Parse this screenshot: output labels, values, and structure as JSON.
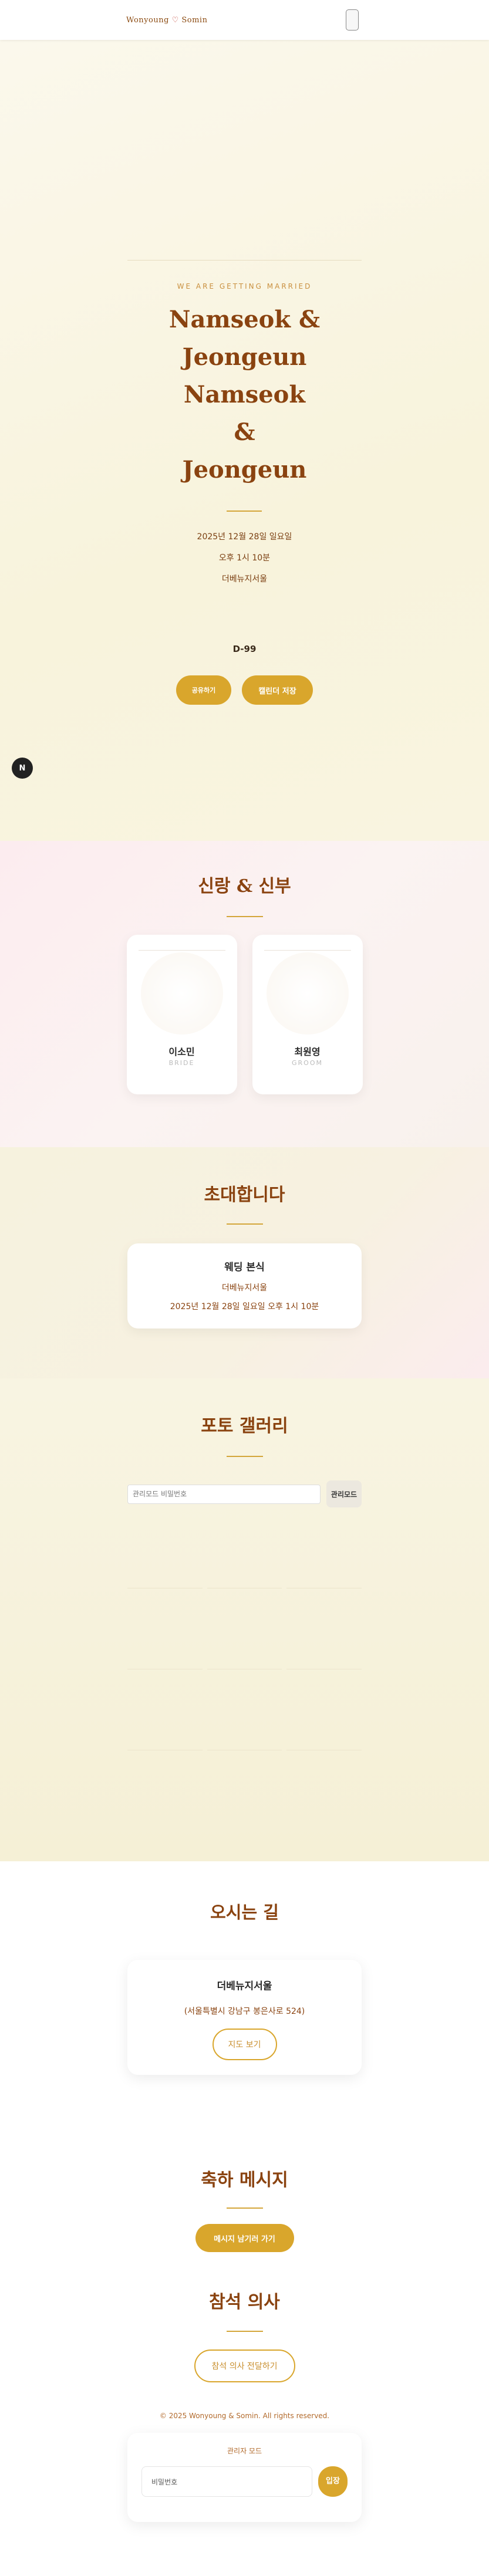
{
  "header": {
    "logo_left": "Wonyoung",
    "logo_heart": "♡",
    "logo_right": "Somin"
  },
  "hero": {
    "tagline": "WE ARE GETTING MARRIED",
    "names": [
      "Namseok &",
      "Jeongeun",
      "Namseok",
      "&",
      "Jeongeun"
    ],
    "date": "2025년 12월 28일 일요일",
    "time": "오후 1시 10분",
    "venue": "더베뉴지서울",
    "dday": "D-99",
    "share_label": "공유하기",
    "calendar_label": "캘린더 저장",
    "badge": "N"
  },
  "couple": {
    "title": "신랑 & 신부",
    "bride": {
      "name": "이소민",
      "role": "BRIDE"
    },
    "groom": {
      "name": "최원영",
      "role": "GROOM"
    }
  },
  "invitation": {
    "title": "초대합니다",
    "card_title": "웨딩 본식",
    "venue": "더베뉴지서울",
    "datetime": "2025년 12월 28일 일요일 오후 1시 10분"
  },
  "gallery": {
    "title": "포토 갤러리",
    "admin_placeholder": "관리모드 비밀번호",
    "admin_button": "관리모드"
  },
  "directions": {
    "title": "오시는 길",
    "venue": "더베뉴지서울",
    "address": "(서울특별시 강남구 봉은사로 524)",
    "map_button": "지도 보기"
  },
  "messages": {
    "title": "축하 메시지",
    "button": "메시지 남기러 가기"
  },
  "rsvp": {
    "title": "참석 의사",
    "button": "참석 의사 전달하기"
  },
  "footer": {
    "copyright": "© 2025 Wonyoung & Somin. All rights reserved.",
    "admin_title": "관리자 모드",
    "password_placeholder": "비밀번호",
    "enter_button": "입장"
  },
  "colors": {
    "accent": "#d9a62c",
    "title": "#8a4310"
  }
}
